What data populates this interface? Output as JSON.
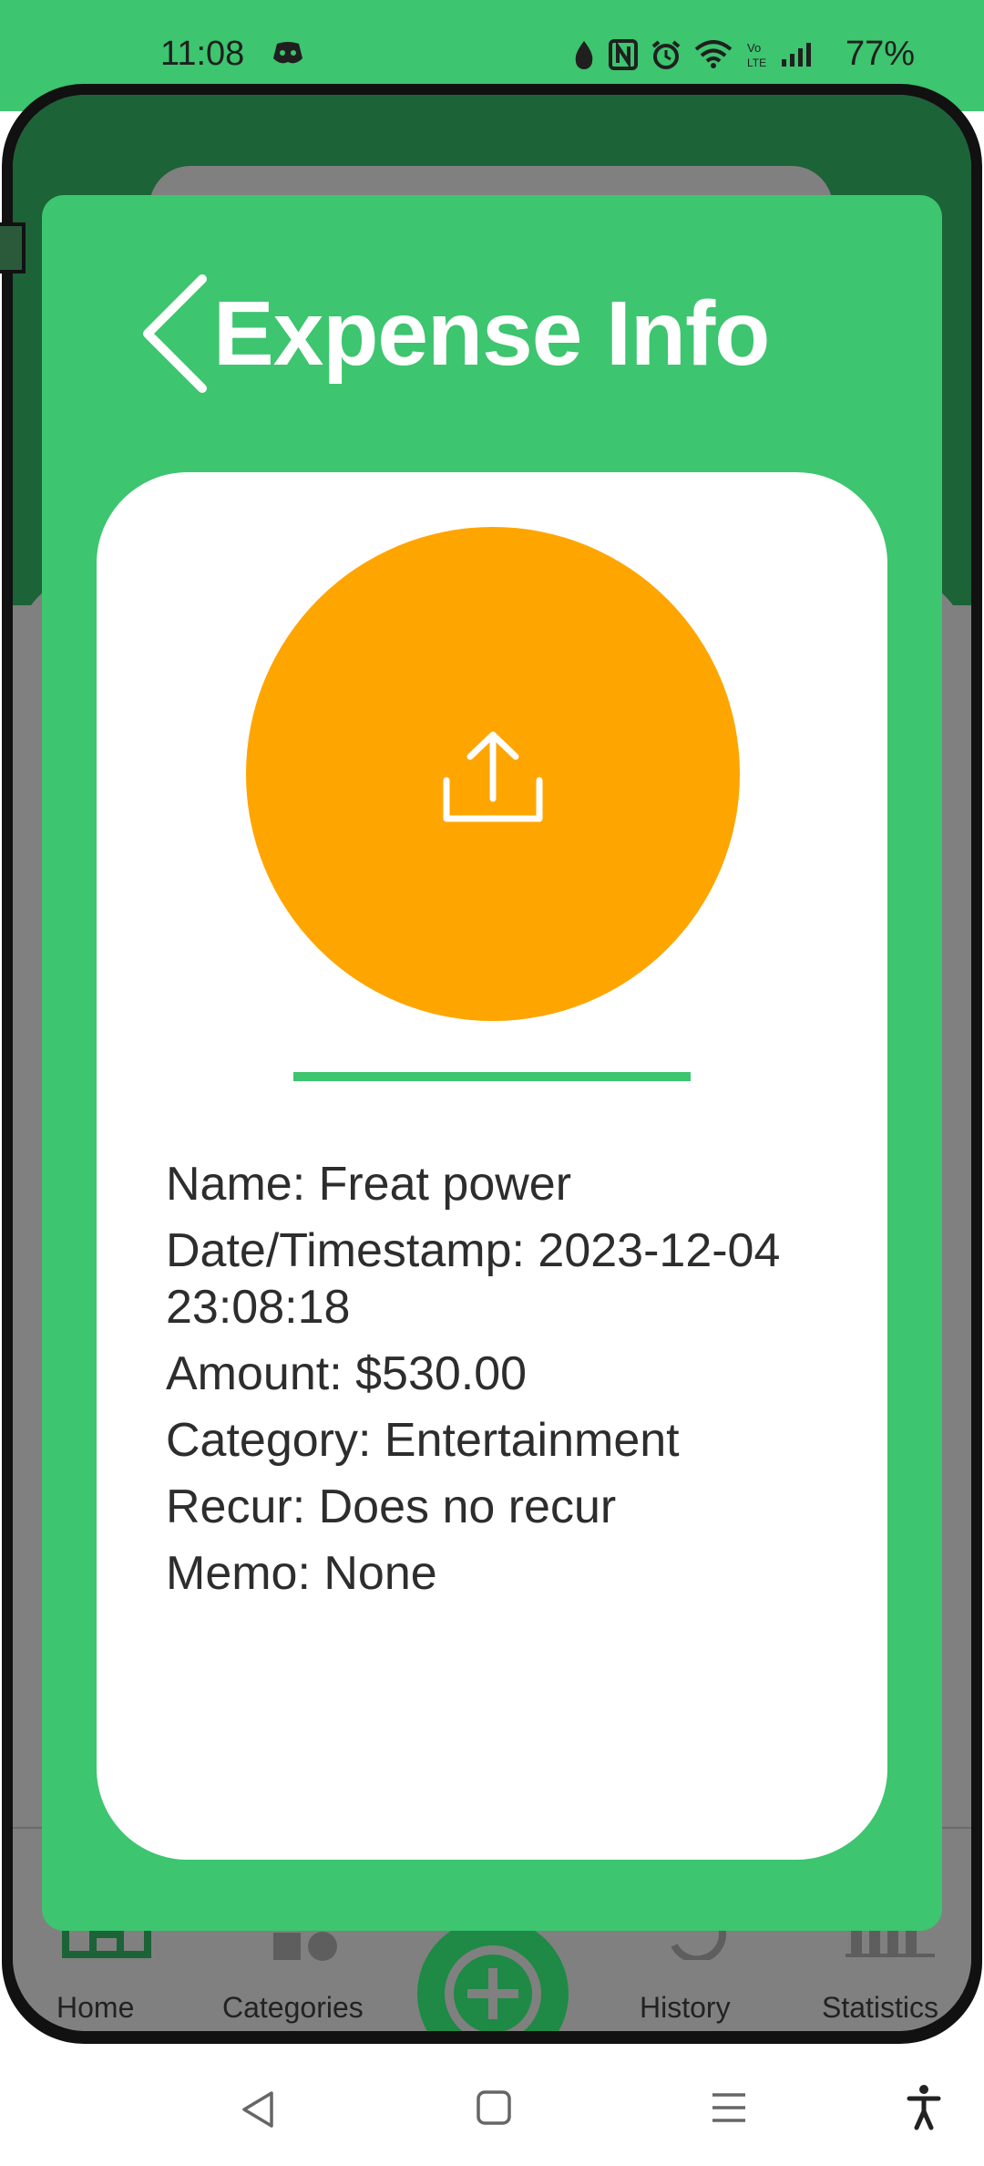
{
  "status_bar": {
    "time": "11:08",
    "battery": "77%",
    "icons": [
      "discord-icon",
      "water-drop-icon",
      "nfc-icon",
      "alarm-icon",
      "wifi-icon",
      "volte-icon",
      "signal-icon"
    ]
  },
  "app_behind": {
    "nav": [
      {
        "label": "Home",
        "icon": "home-icon"
      },
      {
        "label": "Categories",
        "icon": "categories-icon"
      },
      {
        "label": "History",
        "icon": "history-icon"
      },
      {
        "label": "Statistics",
        "icon": "statistics-icon"
      }
    ],
    "fab_icon": "add-icon"
  },
  "modal": {
    "title": "Expense Info",
    "back_icon": "chevron-left-icon",
    "upload_icon": "share-upload-icon",
    "details": {
      "name": "Name: Freat power",
      "date_line1": "Date/Timestamp: 2023-12-04",
      "date_line2": "23:08:18",
      "amount": "Amount: $530.00",
      "category": "Category: Entertainment",
      "recur": "Recur: Does no recur",
      "memo": "Memo: None"
    }
  },
  "colors": {
    "accent_green": "#3dc56f",
    "dark_green": "#1c6338",
    "upload_orange": "#ffa500",
    "text": "#2d2d2d"
  }
}
